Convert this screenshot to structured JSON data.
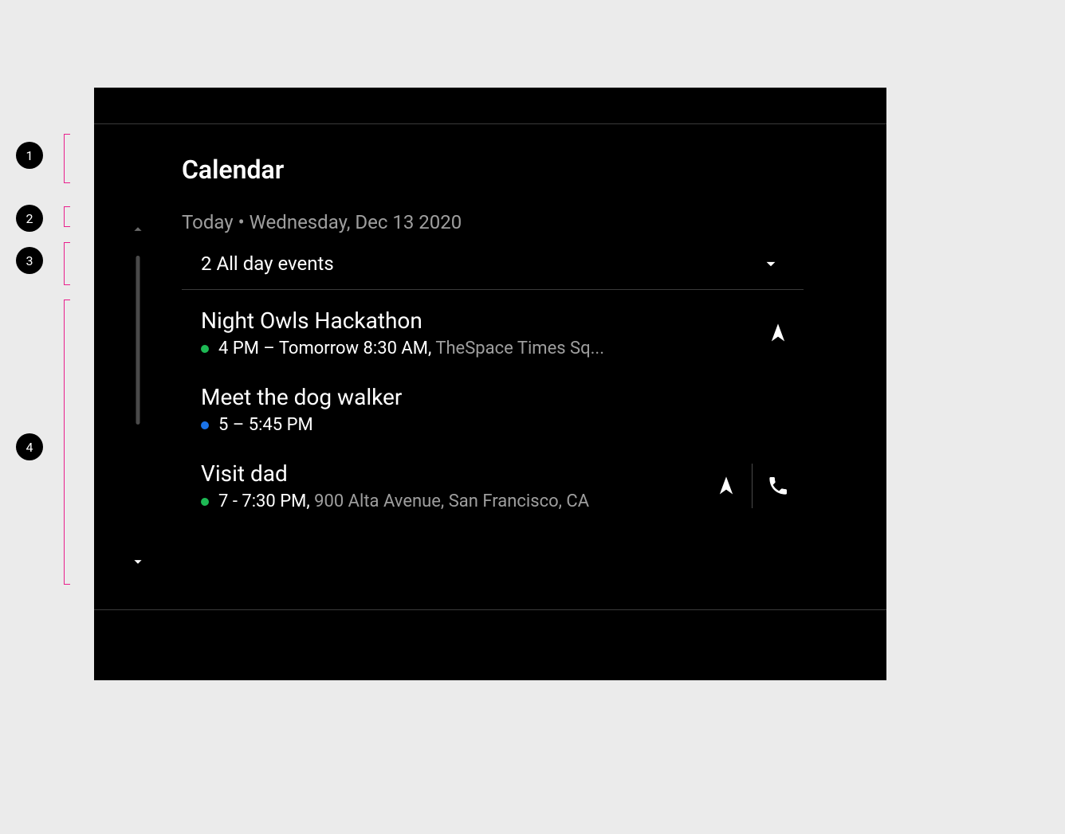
{
  "annotations": {
    "1": "1",
    "2": "2",
    "3": "3",
    "4": "4"
  },
  "app": {
    "title": "Calendar",
    "date_label": "Today • Wednesday, Dec 13 2020",
    "allday_label": "2 All day events"
  },
  "events": [
    {
      "title": "Night Owls Hackathon",
      "time": "4 PM – Tomorrow 8:30 AM, ",
      "location": "TheSpace Times Sq...",
      "color": "green",
      "has_nav": true,
      "has_phone": false
    },
    {
      "title": "Meet the dog walker",
      "time": "5 – 5:45 PM",
      "location": "",
      "color": "blue",
      "has_nav": false,
      "has_phone": false
    },
    {
      "title": "Visit dad",
      "time": "7 - 7:30 PM, ",
      "location": "900 Alta Avenue, San Francisco, CA",
      "color": "green",
      "has_nav": true,
      "has_phone": true
    }
  ]
}
